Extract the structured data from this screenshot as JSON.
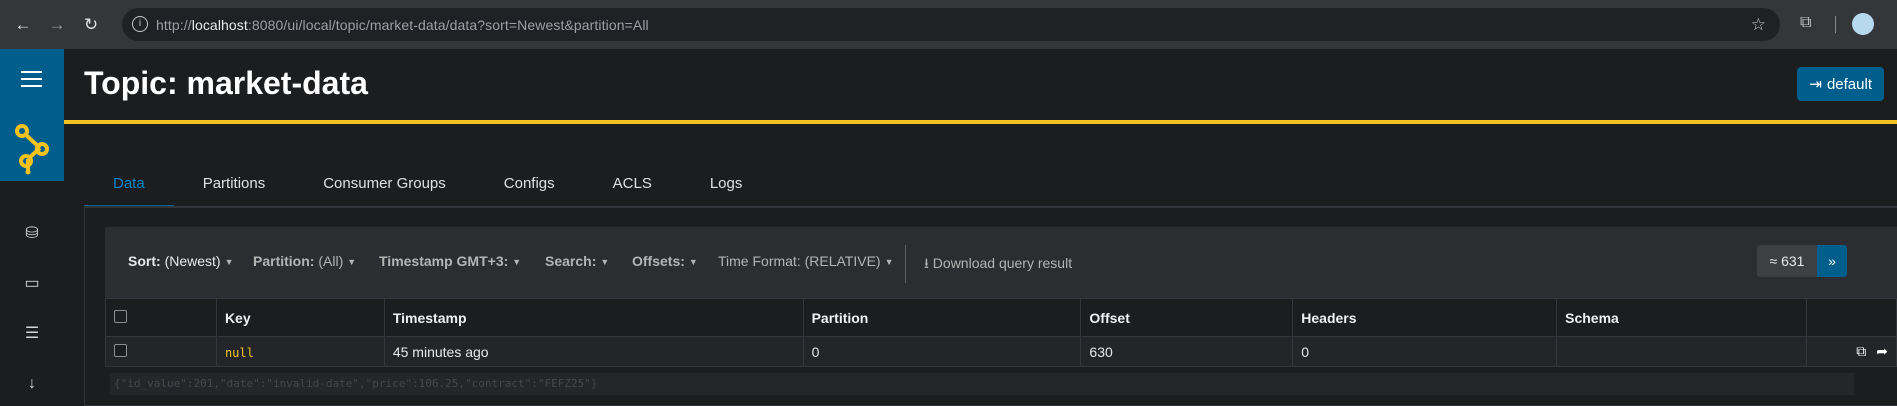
{
  "browser": {
    "url_prefix": "http://",
    "url_host": "localhost",
    "url_rest": ":8080/ui/local/topic/market-data/data?sort=Newest&partition=All"
  },
  "header": {
    "title": "Topic: market-data",
    "user_button": "default"
  },
  "tabs": [
    "Data",
    "Partitions",
    "Consumer Groups",
    "Configs",
    "ACLS",
    "Logs"
  ],
  "toolbar": {
    "sort_label": "Sort:",
    "sort_value": "(Newest)",
    "partition_label": "Partition:",
    "partition_value": "(All)",
    "timestamp": "Timestamp GMT+3:",
    "search": "Search:",
    "offsets": "Offsets:",
    "time_format_label": "Time Format:",
    "time_format_value": "(RELATIVE)",
    "download": "Download query result",
    "count": "≈ 631",
    "next": "»"
  },
  "table": {
    "columns": [
      "Key",
      "Timestamp",
      "Partition",
      "Offset",
      "Headers",
      "Schema"
    ],
    "row": {
      "key": "null",
      "timestamp": "45 minutes ago",
      "partition": "0",
      "offset": "630",
      "headers": "0",
      "schema": ""
    },
    "value": "{\"id_value\":201,\"date\":\"invalid-date\",\"price\":106.25,\"contract\":\"FEFZ25\"}"
  },
  "colors": {
    "accent_yellow": "#f3c220",
    "brand_blue": "#005e8c",
    "tab_active": "#0786c5"
  }
}
